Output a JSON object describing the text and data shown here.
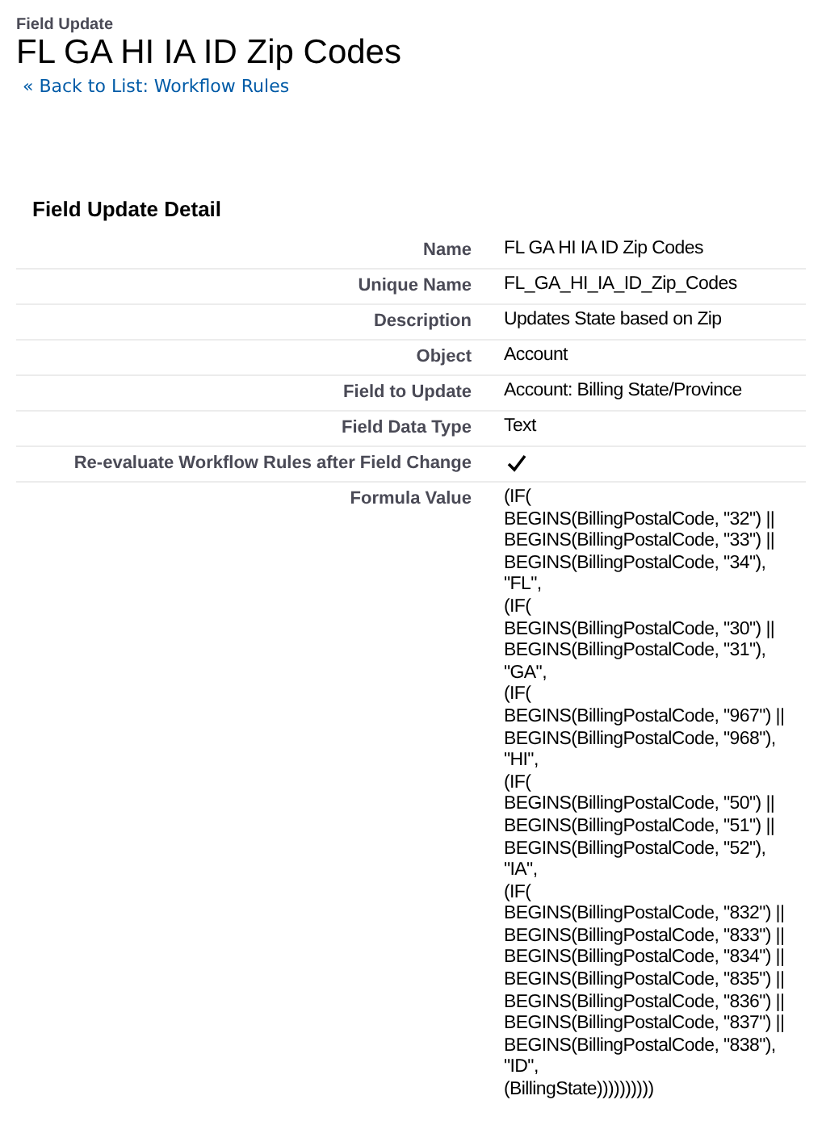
{
  "header": {
    "type_label": "Field Update",
    "title": "FL GA HI IA ID Zip Codes",
    "back_link": "« Back to List: Workflow Rules"
  },
  "section": {
    "title": "Field Update Detail",
    "rows": [
      {
        "kind": "text",
        "label": "Name",
        "value": "FL GA HI IA ID Zip Codes"
      },
      {
        "kind": "text",
        "label": "Unique Name",
        "value": "FL_GA_HI_IA_ID_Zip_Codes"
      },
      {
        "kind": "text",
        "label": "Description",
        "value": "Updates State based on Zip"
      },
      {
        "kind": "text",
        "label": "Object",
        "value": "Account"
      },
      {
        "kind": "text",
        "label": "Field to Update",
        "value": "Account: Billing State/Province"
      },
      {
        "kind": "text",
        "label": "Field Data Type",
        "value": "Text"
      },
      {
        "kind": "check",
        "label": "Re-evaluate Workflow Rules after Field Change",
        "checked": true
      },
      {
        "kind": "text",
        "label": "Formula Value",
        "value": "(IF(\nBEGINS(BillingPostalCode, \"32\") ||\nBEGINS(BillingPostalCode, \"33\") ||\nBEGINS(BillingPostalCode, \"34\"),\n\"FL\",\n(IF(\nBEGINS(BillingPostalCode, \"30\") ||\nBEGINS(BillingPostalCode, \"31\"),\n\"GA\",\n(IF(\nBEGINS(BillingPostalCode, \"967\") ||\nBEGINS(BillingPostalCode, \"968\"),\n\"HI\",\n(IF(\nBEGINS(BillingPostalCode, \"50\") ||\nBEGINS(BillingPostalCode, \"51\") ||\nBEGINS(BillingPostalCode, \"52\"),\n\"IA\",\n(IF(\nBEGINS(BillingPostalCode, \"832\") ||\nBEGINS(BillingPostalCode, \"833\") ||\nBEGINS(BillingPostalCode, \"834\") ||\nBEGINS(BillingPostalCode, \"835\") ||\nBEGINS(BillingPostalCode, \"836\") ||\nBEGINS(BillingPostalCode, \"837\") ||\nBEGINS(BillingPostalCode, \"838\"),\n\"ID\",\n(BillingState))))))))))"
      }
    ]
  }
}
